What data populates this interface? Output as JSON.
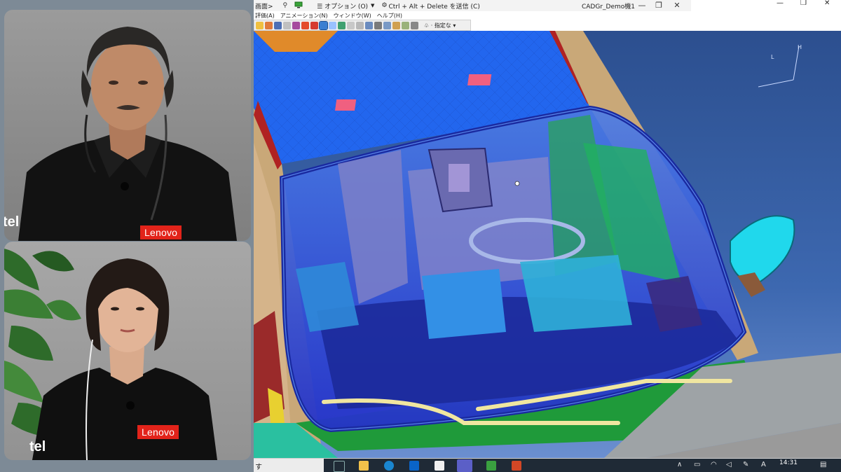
{
  "remote_bar": {
    "session_suffix": "画面>",
    "options_label": "☰ オプション (O)",
    "cad_label": "Ctrl + Alt + Delete を送信 (C)",
    "title": "CADGr_Demo機1"
  },
  "app_menu": {
    "items": [
      "評価(A)",
      "アニメーション(N)",
      "ウィンドウ(W)",
      "ヘルプ(H)"
    ]
  },
  "toolbar": {
    "select_label": "指定な"
  },
  "taskbar": {
    "left_text": "す",
    "clock_time": "14:31",
    "icons": [
      "task-view-icon",
      "file-explorer-icon",
      "edge-icon",
      "outlook-icon",
      "window-icon",
      "teams-icon",
      "cloud-icon",
      "powerpoint-icon"
    ]
  },
  "webcam": {
    "top_badge": "Lenovo",
    "bottom_badge": "Lenovo",
    "top_intel": "tel",
    "bottom_intel": "tel"
  },
  "viewport": {
    "axis_labels": [
      "L",
      "H"
    ]
  },
  "colors": {
    "car_blue": "#1e5ef0",
    "body_tan": "#c9a878",
    "mirror_cyan": "#20d8ec",
    "interior_green": "#20b060",
    "windshield_tint": "#3246d8",
    "background_sky_top": "#2c4f8f",
    "lenovo_red": "#e2231a"
  }
}
